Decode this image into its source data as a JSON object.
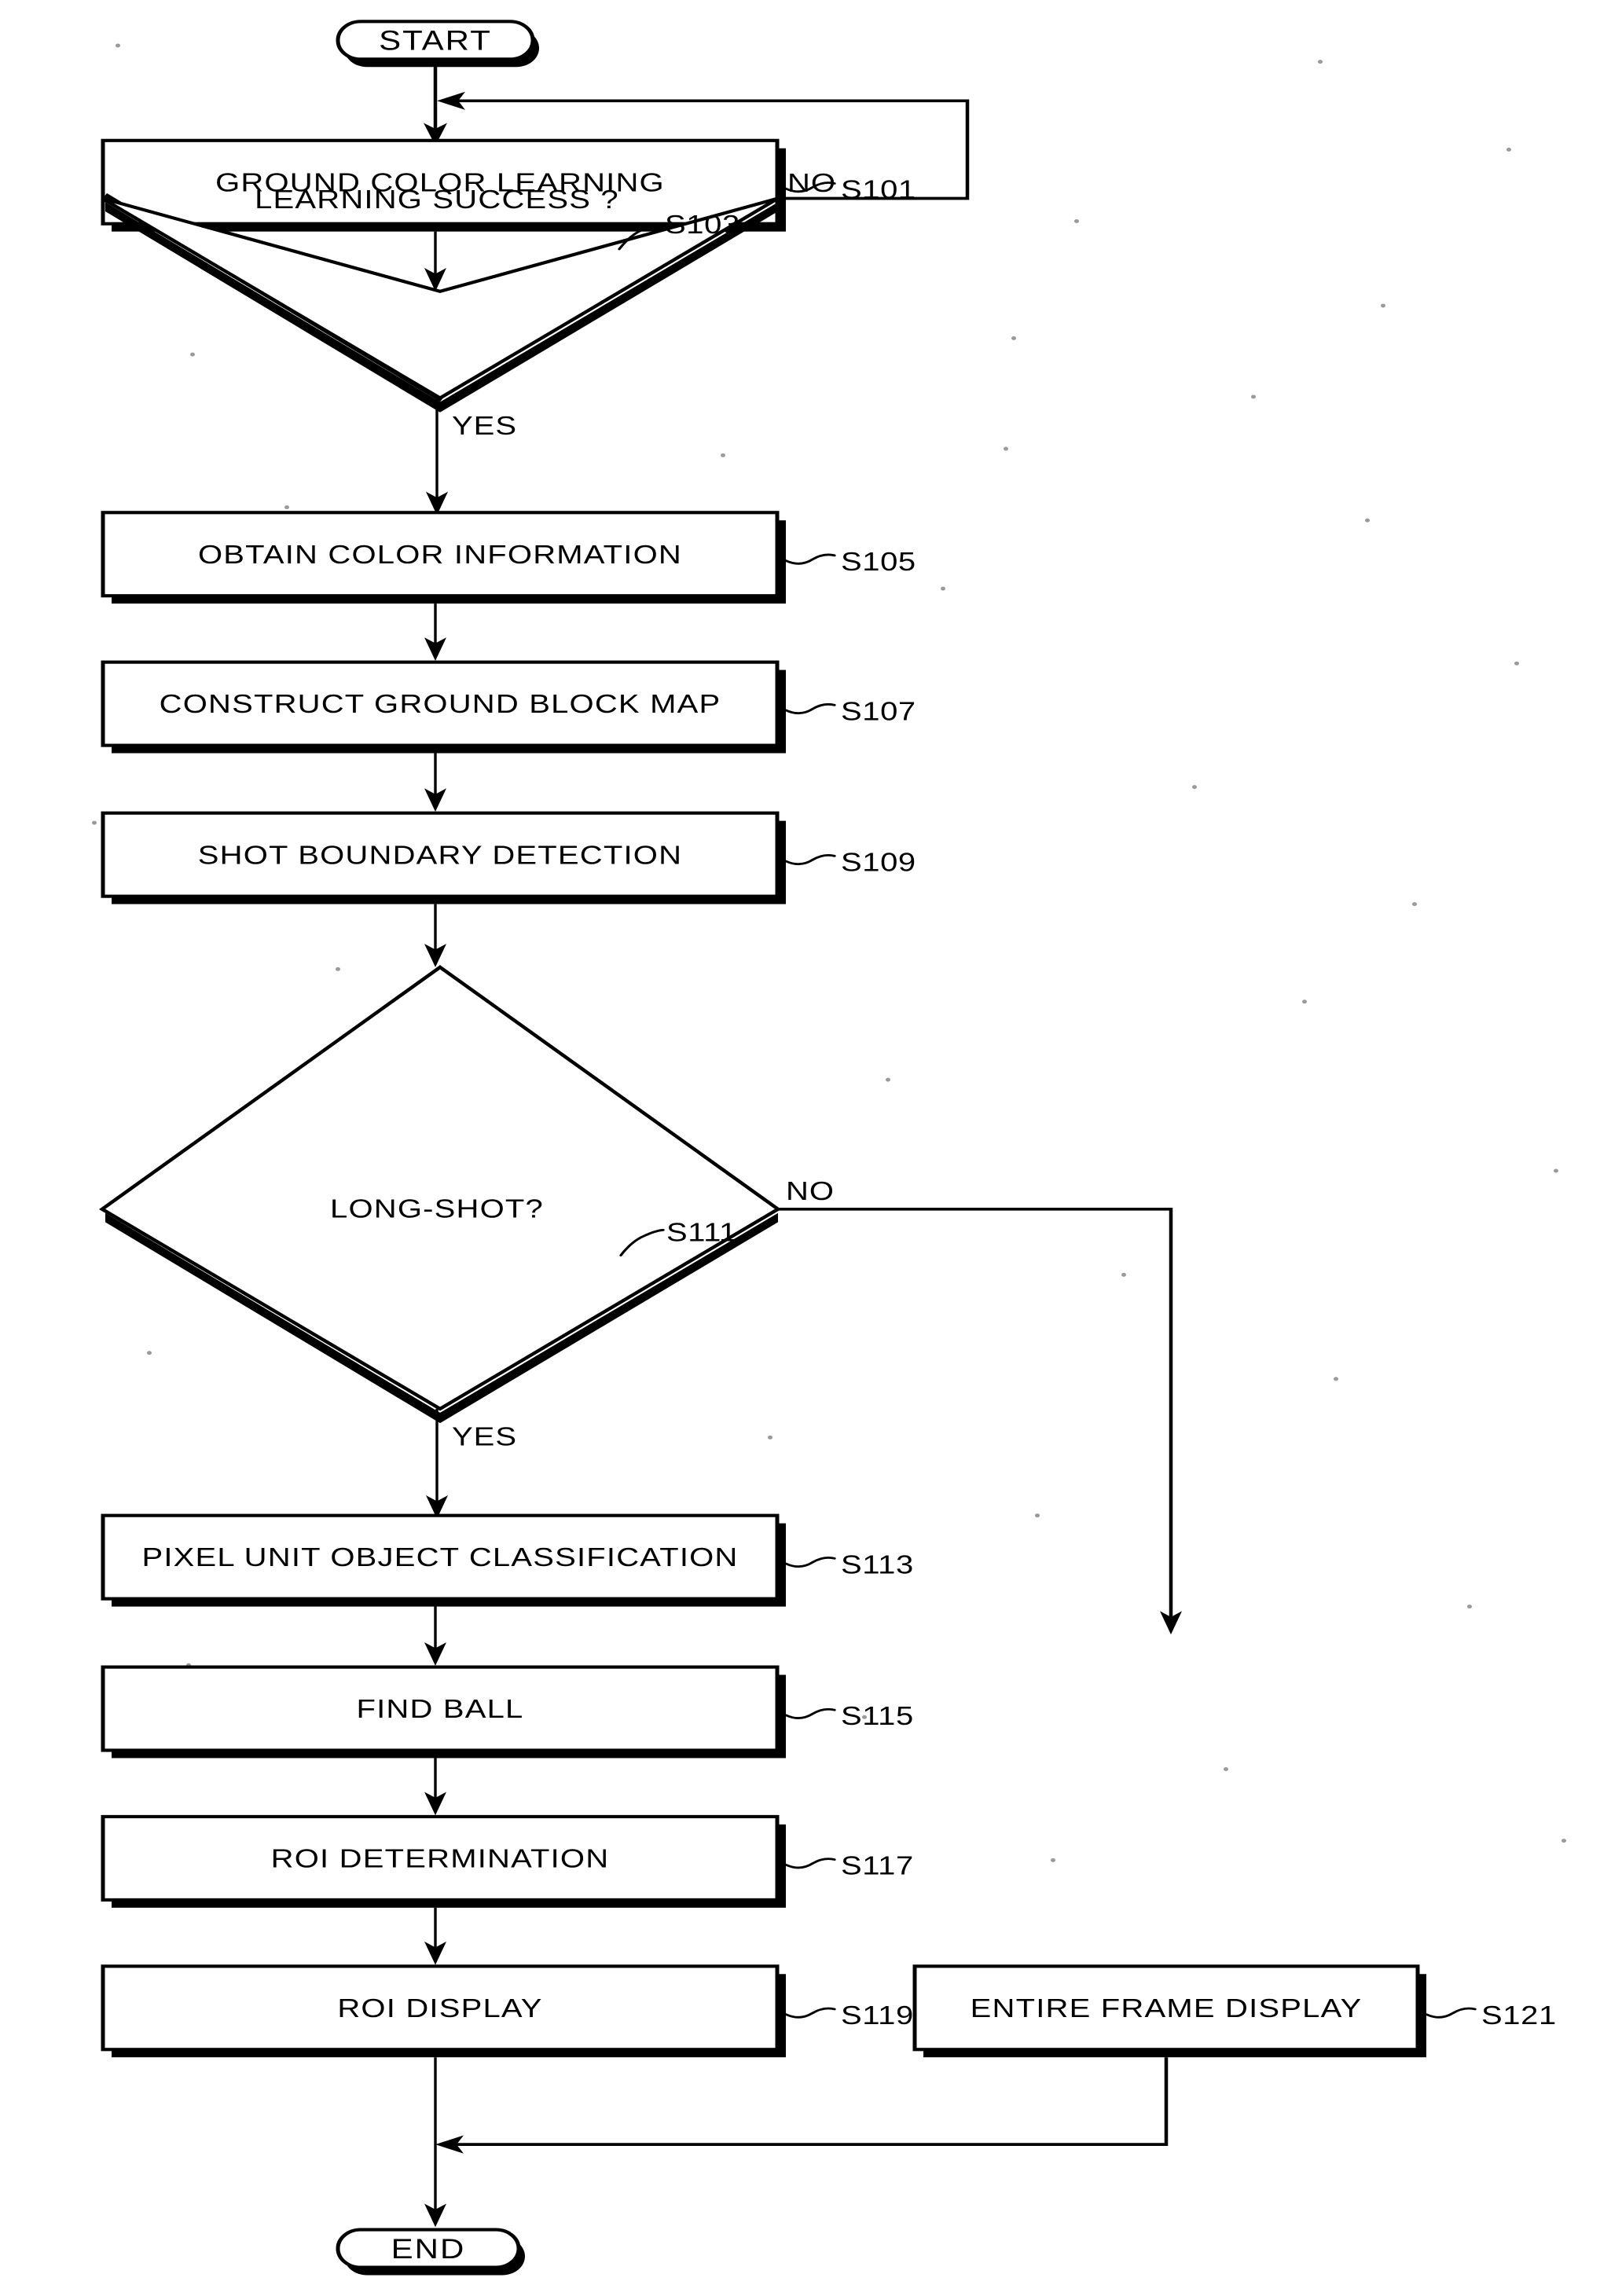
{
  "diagram": {
    "type": "flowchart",
    "title": "",
    "terminators": {
      "start": "START",
      "end": "END"
    },
    "process_steps": [
      {
        "id": "S101",
        "label": "GROUND COLOR LEARNING"
      },
      {
        "id": "S105",
        "label": "OBTAIN COLOR INFORMATION"
      },
      {
        "id": "S107",
        "label": "CONSTRUCT GROUND BLOCK MAP"
      },
      {
        "id": "S109",
        "label": "SHOT BOUNDARY DETECTION"
      },
      {
        "id": "S113",
        "label": "PIXEL UNIT OBJECT CLASSIFICATION"
      },
      {
        "id": "S115",
        "label": "FIND BALL"
      },
      {
        "id": "S117",
        "label": "ROI DETERMINATION"
      },
      {
        "id": "S119",
        "label": "ROI DISPLAY"
      },
      {
        "id": "S121",
        "label": "ENTIRE FRAME DISPLAY"
      }
    ],
    "decisions": [
      {
        "id": "S103",
        "label": "LEARNING SUCCESS ?",
        "yes": "YES",
        "no": "NO"
      },
      {
        "id": "S111",
        "label": "LONG-SHOT?",
        "yes": "YES",
        "no": "NO"
      }
    ],
    "step_ids": {
      "s101": "S101",
      "s103": "S103",
      "s105": "S105",
      "s107": "S107",
      "s109": "S109",
      "s111": "S111",
      "s113": "S113",
      "s115": "S115",
      "s117": "S117",
      "s119": "S119",
      "s121": "S121"
    },
    "branch_labels": {
      "s103_no": "NO",
      "s103_yes": "YES",
      "s111_no": "NO",
      "s111_yes": "YES"
    },
    "colors": {
      "ink": "#000000",
      "paper": "#ffffff"
    }
  }
}
